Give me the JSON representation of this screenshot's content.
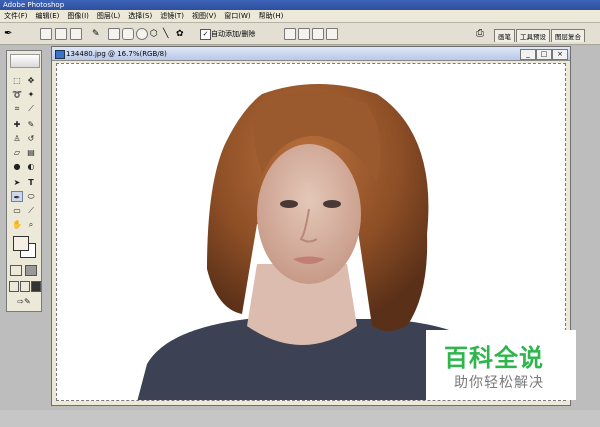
{
  "app": {
    "title": "Adobe Photoshop"
  },
  "menu": [
    "文件(F)",
    "编辑(E)",
    "图像(I)",
    "图层(L)",
    "选择(S)",
    "滤镜(T)",
    "视图(V)",
    "窗口(W)",
    "帮助(H)"
  ],
  "options": {
    "auto_add_delete": "自动添加/删除",
    "checked_mark": "✓"
  },
  "palettes": [
    "画笔",
    "工具预设",
    "图层复合"
  ],
  "document": {
    "title": "134480.jpg @ 16.7%(RGB/8)"
  },
  "watermark": {
    "brand": "百科全说",
    "tagline": "助你轻松解决"
  },
  "colors": {
    "foreground": "#f5efe4",
    "background": "#ffffff",
    "watermark_green": "#2fb54c"
  }
}
